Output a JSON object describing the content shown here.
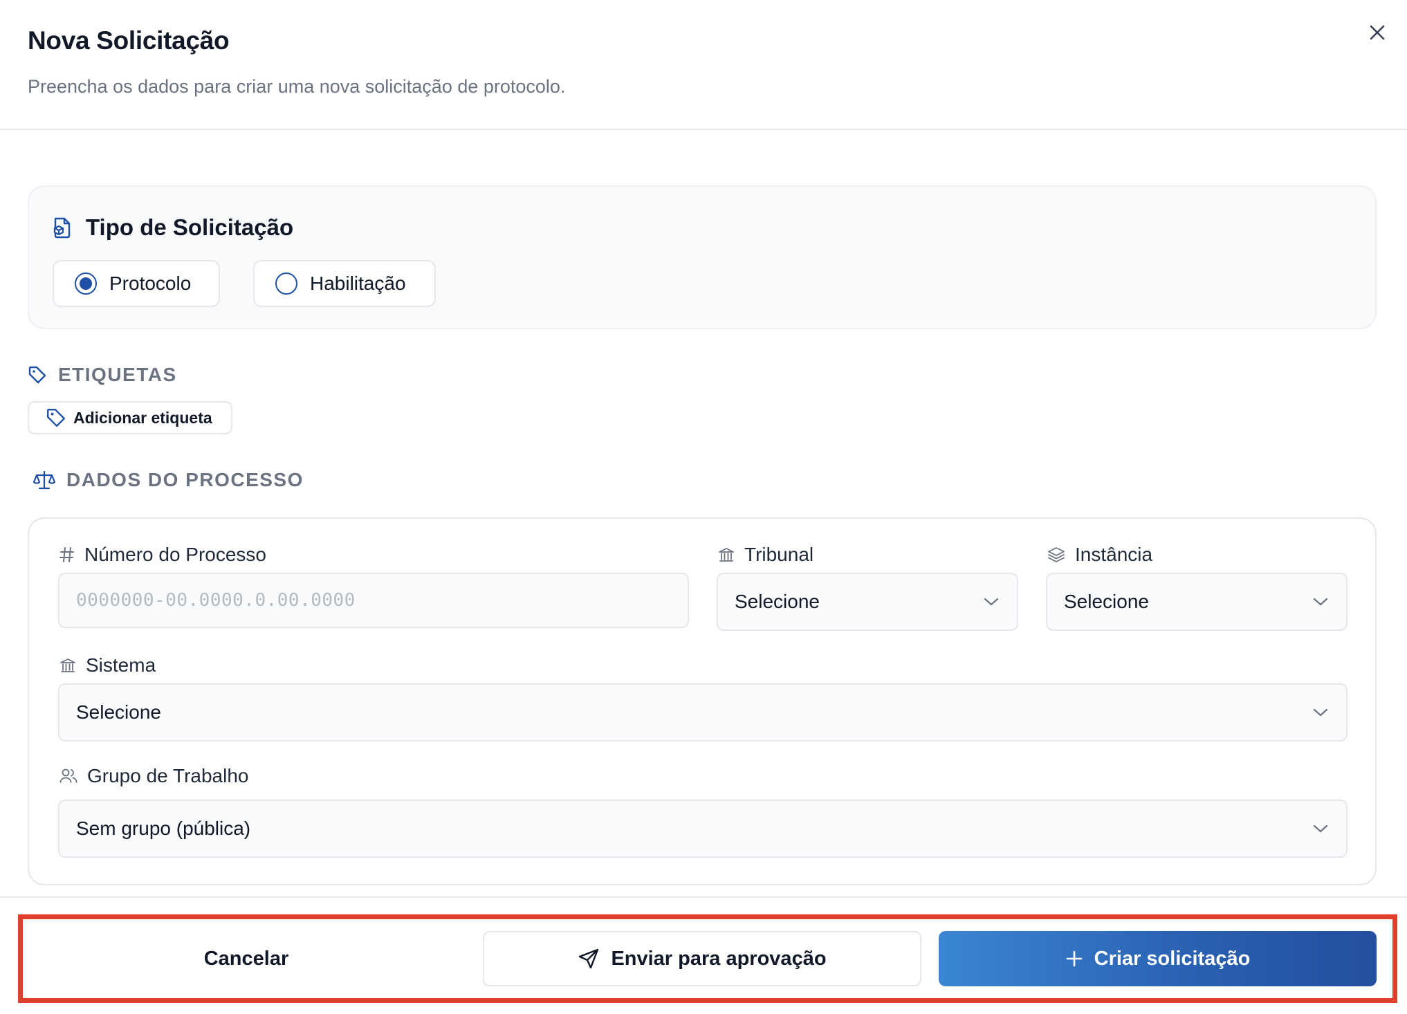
{
  "dialog": {
    "title": "Nova Solicitação",
    "subtitle": "Preencha os dados para criar uma nova solicitação de protocolo."
  },
  "request_type": {
    "title": "Tipo de Solicitação",
    "options": [
      {
        "label": "Protocolo",
        "selected": true
      },
      {
        "label": "Habilitação",
        "selected": false
      }
    ]
  },
  "tags": {
    "section_title": "ETIQUETAS",
    "add_button": "Adicionar etiqueta"
  },
  "process": {
    "section_title": "DADOS DO PROCESSO",
    "numero": {
      "label": "Número do Processo",
      "placeholder": "0000000-00.0000.0.00.0000"
    },
    "tribunal": {
      "label": "Tribunal",
      "value": "Selecione"
    },
    "instancia": {
      "label": "Instância",
      "value": "Selecione"
    },
    "sistema": {
      "label": "Sistema",
      "value": "Selecione"
    },
    "grupo": {
      "label": "Grupo de Trabalho",
      "value": "Sem grupo (pública)"
    }
  },
  "footer": {
    "cancel": "Cancelar",
    "approve": "Enviar para aprovação",
    "create": "Criar solicitação"
  },
  "colors": {
    "accent": "#1e4fa3",
    "primary_gradient_start": "#3a86d4",
    "primary_gradient_end": "#244f9e",
    "highlight": "#e0402b"
  },
  "icons": [
    "close-icon",
    "file-type-icon",
    "tag-icon",
    "scale-icon",
    "hash-icon",
    "bank-icon",
    "layers-icon",
    "users-icon",
    "chevron-down-icon",
    "send-icon",
    "plus-icon"
  ]
}
